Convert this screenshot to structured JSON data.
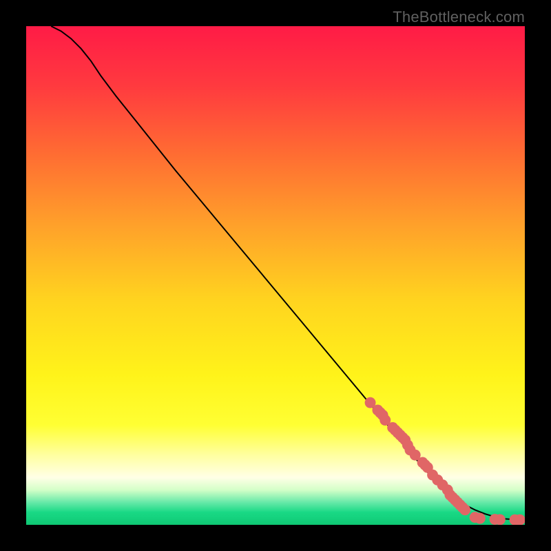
{
  "watermark": "TheBottleneck.com",
  "chart_data": {
    "type": "line",
    "title": "",
    "xlabel": "",
    "ylabel": "",
    "xlim": [
      0,
      100
    ],
    "ylim": [
      0,
      100
    ],
    "background_gradient_stops": [
      {
        "offset": 0.0,
        "color": "#ff1b46"
      },
      {
        "offset": 0.12,
        "color": "#ff3a3f"
      },
      {
        "offset": 0.25,
        "color": "#ff6a33"
      },
      {
        "offset": 0.4,
        "color": "#ffa12a"
      },
      {
        "offset": 0.55,
        "color": "#ffd41f"
      },
      {
        "offset": 0.7,
        "color": "#fff31a"
      },
      {
        "offset": 0.8,
        "color": "#ffff33"
      },
      {
        "offset": 0.86,
        "color": "#ffffa0"
      },
      {
        "offset": 0.905,
        "color": "#ffffe6"
      },
      {
        "offset": 0.93,
        "color": "#d4ffc8"
      },
      {
        "offset": 0.955,
        "color": "#66e9a8"
      },
      {
        "offset": 0.975,
        "color": "#19d985"
      },
      {
        "offset": 1.0,
        "color": "#0fc874"
      }
    ],
    "series": [
      {
        "name": "curve",
        "type": "line",
        "x": [
          5,
          7,
          9,
          11,
          13,
          15,
          18,
          22,
          26,
          30,
          35,
          40,
          45,
          50,
          55,
          60,
          65,
          70,
          75,
          80,
          82,
          84,
          86,
          88,
          90,
          92,
          94,
          96,
          98,
          100
        ],
        "y": [
          100,
          99,
          97.5,
          95.5,
          93,
          90,
          86,
          81,
          76,
          71,
          65,
          59,
          53,
          47,
          41,
          35,
          29,
          23,
          17,
          11,
          9,
          7,
          5.5,
          4,
          3,
          2.2,
          1.6,
          1.2,
          1.05,
          1
        ]
      },
      {
        "name": "points",
        "type": "scatter",
        "x": [
          69,
          70.5,
          71,
          71.5,
          72,
          73.5,
          74,
          74.5,
          75,
          75.5,
          76,
          76.5,
          77,
          78,
          79.5,
          80,
          80.5,
          81.5,
          82.5,
          83.5,
          84.5,
          85,
          85.5,
          86,
          86.5,
          87,
          87.5,
          88,
          90,
          91,
          94,
          95,
          98,
          99
        ],
        "y": [
          24.5,
          23,
          22.5,
          22,
          21,
          19.5,
          19,
          18.5,
          18,
          17.5,
          17,
          16,
          15,
          14,
          12.5,
          12,
          11.5,
          10,
          9,
          8,
          7,
          6,
          5.5,
          5,
          4.5,
          4,
          3.5,
          3,
          1.5,
          1.3,
          1.1,
          1.05,
          1,
          1
        ],
        "marker_radius_frac": 0.011,
        "marker_color": "#e06666"
      }
    ]
  }
}
